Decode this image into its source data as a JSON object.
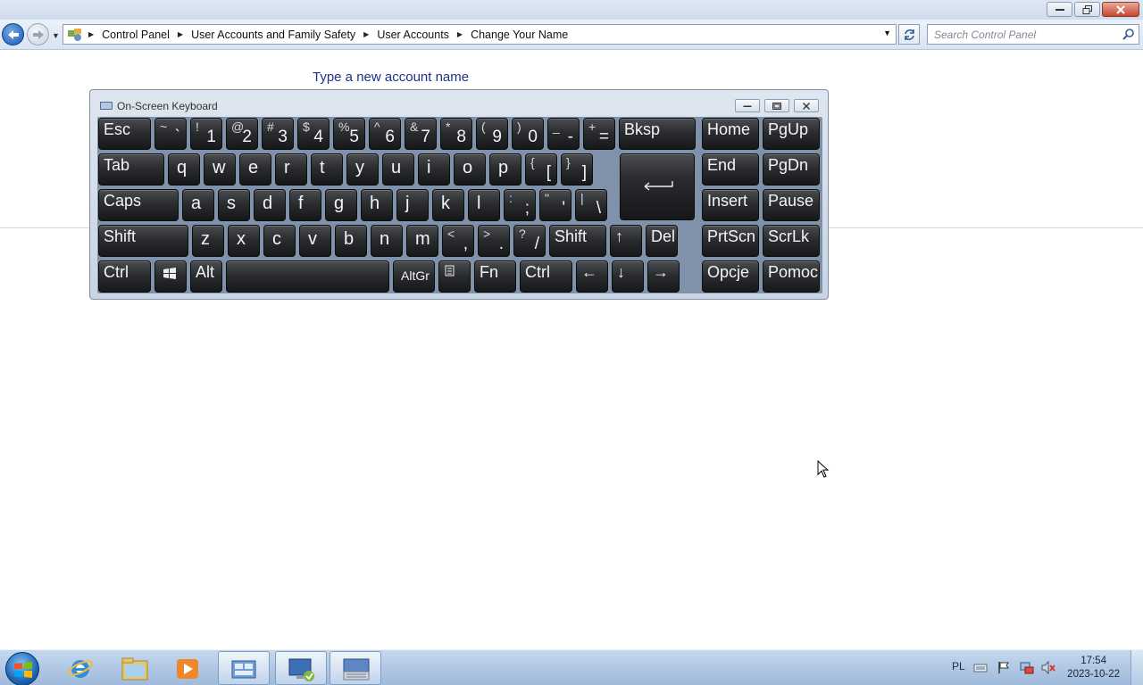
{
  "window": {
    "caption_buttons": [
      "minimize-icon",
      "restore-icon",
      "close-icon"
    ]
  },
  "nav": {
    "breadcrumbs": [
      "Control Panel",
      "User Accounts and Family Safety",
      "User Accounts",
      "Change Your Name"
    ],
    "search_placeholder": "Search Control Panel"
  },
  "content": {
    "heading": "Type a new account name"
  },
  "osk": {
    "title": "On-Screen Keyboard",
    "row1": [
      {
        "label": "Esc"
      },
      {
        "shift": "~",
        "base": "`"
      },
      {
        "shift": "!",
        "base": "1"
      },
      {
        "shift": "@",
        "base": "2"
      },
      {
        "shift": "#",
        "base": "3"
      },
      {
        "shift": "$",
        "base": "4"
      },
      {
        "shift": "%",
        "base": "5"
      },
      {
        "shift": "^",
        "base": "6"
      },
      {
        "shift": "&",
        "base": "7"
      },
      {
        "shift": "*",
        "base": "8"
      },
      {
        "shift": "(",
        "base": "9"
      },
      {
        "shift": ")",
        "base": "0"
      },
      {
        "shift": "_",
        "base": "-"
      },
      {
        "shift": "+",
        "base": "="
      },
      {
        "label": "Bksp"
      },
      {
        "label": "Home"
      },
      {
        "label": "PgUp"
      }
    ],
    "row2": [
      {
        "label": "Tab"
      },
      {
        "label": "q"
      },
      {
        "label": "w"
      },
      {
        "label": "e"
      },
      {
        "label": "r"
      },
      {
        "label": "t"
      },
      {
        "label": "y"
      },
      {
        "label": "u"
      },
      {
        "label": "i"
      },
      {
        "label": "o"
      },
      {
        "label": "p"
      },
      {
        "shift": "{",
        "base": "["
      },
      {
        "shift": "}",
        "base": "]"
      },
      {
        "label": "End"
      },
      {
        "label": "PgDn"
      }
    ],
    "row3": [
      {
        "label": "Caps"
      },
      {
        "label": "a"
      },
      {
        "label": "s"
      },
      {
        "label": "d"
      },
      {
        "label": "f"
      },
      {
        "label": "g"
      },
      {
        "label": "h"
      },
      {
        "label": "j"
      },
      {
        "label": "k"
      },
      {
        "label": "l"
      },
      {
        "shift": ":",
        "base": ";"
      },
      {
        "shift": "\"",
        "base": "'"
      },
      {
        "shift": "|",
        "base": "\\"
      },
      {
        "label": "Insert"
      },
      {
        "label": "Pause"
      }
    ],
    "row4": [
      {
        "label": "Shift"
      },
      {
        "label": "z"
      },
      {
        "label": "x"
      },
      {
        "label": "c"
      },
      {
        "label": "v"
      },
      {
        "label": "b"
      },
      {
        "label": "n"
      },
      {
        "label": "m"
      },
      {
        "shift": "<",
        "base": ","
      },
      {
        "shift": ">",
        "base": "."
      },
      {
        "shift": "?",
        "base": "/"
      },
      {
        "label": "Shift"
      },
      {
        "label": "↑"
      },
      {
        "label": "Del"
      },
      {
        "label": "PrtScn"
      },
      {
        "label": "ScrLk"
      }
    ],
    "row5": [
      {
        "label": "Ctrl"
      },
      {
        "label": ""
      },
      {
        "label": "Alt"
      },
      {
        "label": ""
      },
      {
        "label": "AltGr"
      },
      {
        "label": ""
      },
      {
        "label": "Fn"
      },
      {
        "label": "Ctrl"
      },
      {
        "label": "←"
      },
      {
        "label": "↓"
      },
      {
        "label": "→"
      },
      {
        "label": "Opcje"
      },
      {
        "label": "Pomoc"
      }
    ]
  },
  "taskbar": {
    "apps": [
      "internet-explorer-icon",
      "windows-explorer-icon",
      "media-player-icon",
      "control-panel-icon",
      "remote-desktop-icon",
      "on-screen-keyboard-icon"
    ],
    "language": "PL",
    "time": "17:54",
    "date": "2023-10-22"
  }
}
